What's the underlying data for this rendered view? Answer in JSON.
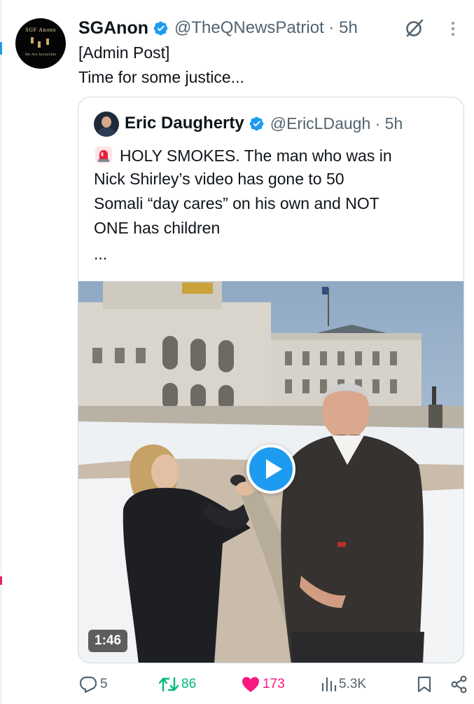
{
  "tweet": {
    "author_name": "SGAnon",
    "handle_time": "@TheQNewsPatriot · 5h",
    "avatar_text": "SGF Anons",
    "avatar_subtext": "We Are Invincible",
    "text_line1": "[Admin Post]",
    "text_line2": "Time for some justice..."
  },
  "quote": {
    "author_name": "Eric Daugherty",
    "handle_time": "@EricLDaugh · 5h",
    "line1": "HOLY SMOKES. The man who was in",
    "line2": "Nick Shirley’s video has gone to 50",
    "line3": "Somali “day cares” on his own and NOT",
    "line4": "ONE has children",
    "ellipsis": "...",
    "video_duration": "1:46"
  },
  "actions": {
    "replies": "5",
    "reposts": "86",
    "likes": "173",
    "views": "5.3K"
  },
  "icons": {
    "verified": "verified-badge-icon",
    "grok": "grok-icon",
    "more": "more-dots-icon",
    "siren": "rotating-light-emoji",
    "play": "play-icon",
    "reply": "reply-icon",
    "repost": "repost-icon",
    "like": "heart-icon",
    "views": "views-chart-icon",
    "bookmark": "bookmark-icon",
    "share": "share-icon"
  },
  "colors": {
    "accent": "#1d9bf0",
    "repost": "#00ba7c",
    "like": "#f91880",
    "secondary_text": "#536471",
    "border": "#cfd9de"
  }
}
